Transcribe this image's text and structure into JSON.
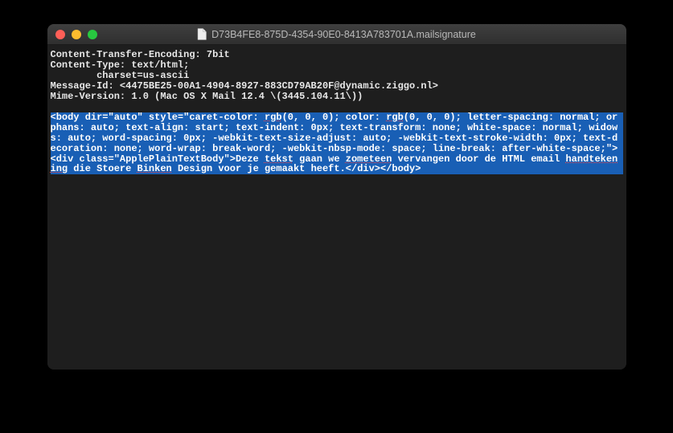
{
  "window": {
    "title": "D73B4FE8-875D-4354-90E0-8413A783701A.mailsignature"
  },
  "headers": {
    "cte": "Content-Transfer-Encoding: 7bit",
    "ct": "Content-Type: text/html;",
    "charset": "        charset=us-ascii",
    "mid": "Message-Id: <4475BE25-00A1-4904-8927-883CD79AB20F@dynamic.ziggo.nl>",
    "mime": "Mime-Version: 1.0 (Mac OS X Mail 12.4 \\(3445.104.11\\))"
  },
  "selection": {
    "p1": "<body dir=\"auto\" style=\"caret-color: ",
    "rgb1": "rgb",
    "p2": "(0, 0, 0); color: ",
    "rgb2": "rgb",
    "p3": "(0, 0, 0); letter-spacing: normal; orphans: auto; text-align: start; text-indent: 0px; text-transform: none; white-space: normal; widows: auto; word-spacing: 0px; -webkit-text-size-adjust: auto; -webkit-text-stroke-width: 0px; text-decoration: none; word-wrap: break-word; -webkit-nbsp-mode: space; line-break: after-white-space;\"><div class=\"ApplePlainTextBody\">Deze ",
    "tekst": "tekst",
    "p4": " gaan we ",
    "zometeen": "zometeen",
    "p5": " vervangen door de HTML email ",
    "handtekening": "handtekening",
    "p6": " die Stoere ",
    "binken": "Binken",
    "p7": " Design voor je gemaakt heeft.</div></body>"
  }
}
